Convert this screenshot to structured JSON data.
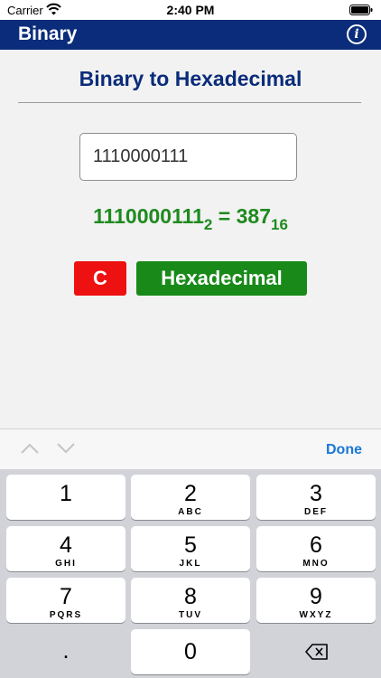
{
  "status_bar": {
    "carrier": "Carrier",
    "time": "2:40 PM"
  },
  "nav": {
    "title": "Binary",
    "info_label": "i"
  },
  "page": {
    "title": "Binary to Hexadecimal"
  },
  "input": {
    "value": "1110000111",
    "placeholder": ""
  },
  "result": {
    "binary": "1110000111",
    "binary_base": "2",
    "equals": " = ",
    "hex": "387",
    "hex_base": "16"
  },
  "buttons": {
    "clear": "C",
    "convert": "Hexadecimal"
  },
  "accessory": {
    "done": "Done"
  },
  "keypad": {
    "keys": [
      {
        "digit": "1",
        "letters": ""
      },
      {
        "digit": "2",
        "letters": "ABC"
      },
      {
        "digit": "3",
        "letters": "DEF"
      },
      {
        "digit": "4",
        "letters": "GHI"
      },
      {
        "digit": "5",
        "letters": "JKL"
      },
      {
        "digit": "6",
        "letters": "MNO"
      },
      {
        "digit": "7",
        "letters": "PQRS"
      },
      {
        "digit": "8",
        "letters": "TUV"
      },
      {
        "digit": "9",
        "letters": "WXYZ"
      }
    ],
    "dot": ".",
    "zero": "0"
  },
  "colors": {
    "nav_background": "#0a2c7a",
    "title": "#0a2c7a",
    "result": "#1e8a1e",
    "clear_button": "#ee1111",
    "convert_button": "#198a19",
    "done_link": "#1a78d6",
    "keypad_background": "#d1d3d9"
  },
  "icons": {
    "wifi": "wifi-icon",
    "battery": "battery-icon",
    "info": "info-icon",
    "previous": "chevron-up-icon",
    "next": "chevron-down-icon",
    "delete": "delete-backspace-icon"
  }
}
